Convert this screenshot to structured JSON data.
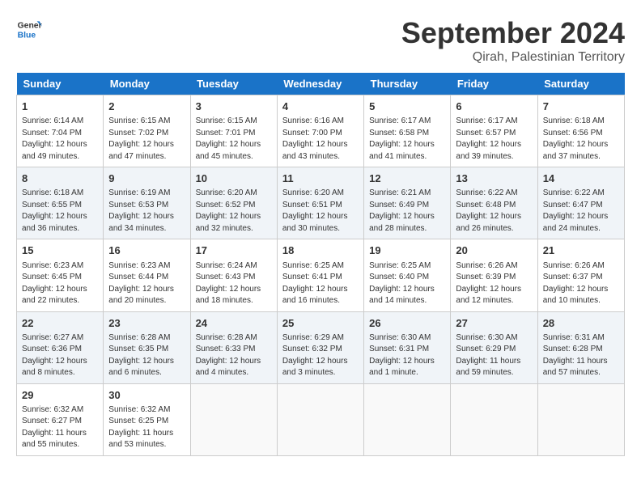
{
  "header": {
    "logo_line1": "General",
    "logo_line2": "Blue",
    "month": "September 2024",
    "location": "Qirah, Palestinian Territory"
  },
  "weekdays": [
    "Sunday",
    "Monday",
    "Tuesday",
    "Wednesday",
    "Thursday",
    "Friday",
    "Saturday"
  ],
  "weeks": [
    [
      {
        "day": "1",
        "info": "Sunrise: 6:14 AM\nSunset: 7:04 PM\nDaylight: 12 hours\nand 49 minutes."
      },
      {
        "day": "2",
        "info": "Sunrise: 6:15 AM\nSunset: 7:02 PM\nDaylight: 12 hours\nand 47 minutes."
      },
      {
        "day": "3",
        "info": "Sunrise: 6:15 AM\nSunset: 7:01 PM\nDaylight: 12 hours\nand 45 minutes."
      },
      {
        "day": "4",
        "info": "Sunrise: 6:16 AM\nSunset: 7:00 PM\nDaylight: 12 hours\nand 43 minutes."
      },
      {
        "day": "5",
        "info": "Sunrise: 6:17 AM\nSunset: 6:58 PM\nDaylight: 12 hours\nand 41 minutes."
      },
      {
        "day": "6",
        "info": "Sunrise: 6:17 AM\nSunset: 6:57 PM\nDaylight: 12 hours\nand 39 minutes."
      },
      {
        "day": "7",
        "info": "Sunrise: 6:18 AM\nSunset: 6:56 PM\nDaylight: 12 hours\nand 37 minutes."
      }
    ],
    [
      {
        "day": "8",
        "info": "Sunrise: 6:18 AM\nSunset: 6:55 PM\nDaylight: 12 hours\nand 36 minutes."
      },
      {
        "day": "9",
        "info": "Sunrise: 6:19 AM\nSunset: 6:53 PM\nDaylight: 12 hours\nand 34 minutes."
      },
      {
        "day": "10",
        "info": "Sunrise: 6:20 AM\nSunset: 6:52 PM\nDaylight: 12 hours\nand 32 minutes."
      },
      {
        "day": "11",
        "info": "Sunrise: 6:20 AM\nSunset: 6:51 PM\nDaylight: 12 hours\nand 30 minutes."
      },
      {
        "day": "12",
        "info": "Sunrise: 6:21 AM\nSunset: 6:49 PM\nDaylight: 12 hours\nand 28 minutes."
      },
      {
        "day": "13",
        "info": "Sunrise: 6:22 AM\nSunset: 6:48 PM\nDaylight: 12 hours\nand 26 minutes."
      },
      {
        "day": "14",
        "info": "Sunrise: 6:22 AM\nSunset: 6:47 PM\nDaylight: 12 hours\nand 24 minutes."
      }
    ],
    [
      {
        "day": "15",
        "info": "Sunrise: 6:23 AM\nSunset: 6:45 PM\nDaylight: 12 hours\nand 22 minutes."
      },
      {
        "day": "16",
        "info": "Sunrise: 6:23 AM\nSunset: 6:44 PM\nDaylight: 12 hours\nand 20 minutes."
      },
      {
        "day": "17",
        "info": "Sunrise: 6:24 AM\nSunset: 6:43 PM\nDaylight: 12 hours\nand 18 minutes."
      },
      {
        "day": "18",
        "info": "Sunrise: 6:25 AM\nSunset: 6:41 PM\nDaylight: 12 hours\nand 16 minutes."
      },
      {
        "day": "19",
        "info": "Sunrise: 6:25 AM\nSunset: 6:40 PM\nDaylight: 12 hours\nand 14 minutes."
      },
      {
        "day": "20",
        "info": "Sunrise: 6:26 AM\nSunset: 6:39 PM\nDaylight: 12 hours\nand 12 minutes."
      },
      {
        "day": "21",
        "info": "Sunrise: 6:26 AM\nSunset: 6:37 PM\nDaylight: 12 hours\nand 10 minutes."
      }
    ],
    [
      {
        "day": "22",
        "info": "Sunrise: 6:27 AM\nSunset: 6:36 PM\nDaylight: 12 hours\nand 8 minutes."
      },
      {
        "day": "23",
        "info": "Sunrise: 6:28 AM\nSunset: 6:35 PM\nDaylight: 12 hours\nand 6 minutes."
      },
      {
        "day": "24",
        "info": "Sunrise: 6:28 AM\nSunset: 6:33 PM\nDaylight: 12 hours\nand 4 minutes."
      },
      {
        "day": "25",
        "info": "Sunrise: 6:29 AM\nSunset: 6:32 PM\nDaylight: 12 hours\nand 3 minutes."
      },
      {
        "day": "26",
        "info": "Sunrise: 6:30 AM\nSunset: 6:31 PM\nDaylight: 12 hours\nand 1 minute."
      },
      {
        "day": "27",
        "info": "Sunrise: 6:30 AM\nSunset: 6:29 PM\nDaylight: 11 hours\nand 59 minutes."
      },
      {
        "day": "28",
        "info": "Sunrise: 6:31 AM\nSunset: 6:28 PM\nDaylight: 11 hours\nand 57 minutes."
      }
    ],
    [
      {
        "day": "29",
        "info": "Sunrise: 6:32 AM\nSunset: 6:27 PM\nDaylight: 11 hours\nand 55 minutes."
      },
      {
        "day": "30",
        "info": "Sunrise: 6:32 AM\nSunset: 6:25 PM\nDaylight: 11 hours\nand 53 minutes."
      },
      {
        "day": "",
        "info": ""
      },
      {
        "day": "",
        "info": ""
      },
      {
        "day": "",
        "info": ""
      },
      {
        "day": "",
        "info": ""
      },
      {
        "day": "",
        "info": ""
      }
    ]
  ]
}
